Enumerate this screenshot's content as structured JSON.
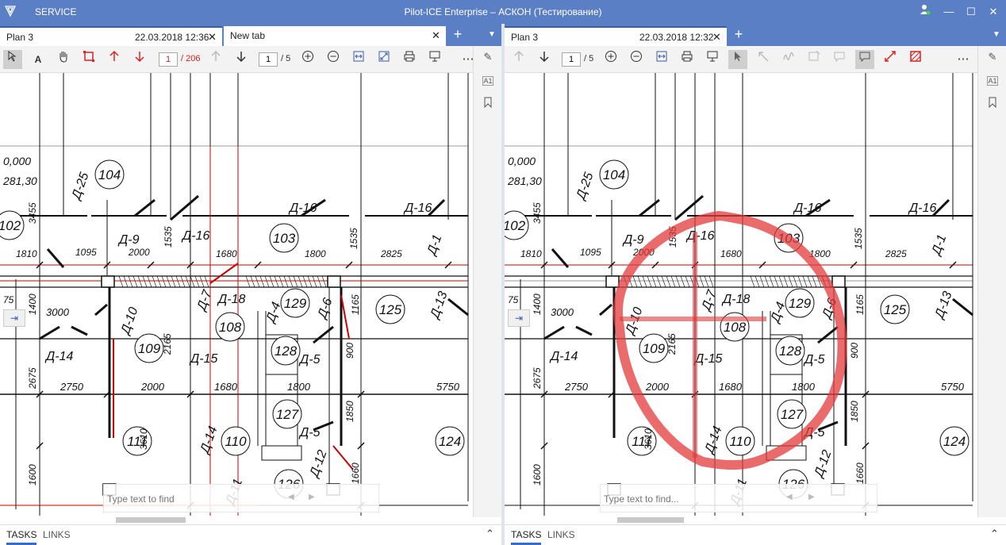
{
  "titlebar": {
    "menu": "SERVICE",
    "title": "Pilot-ICE Enterprise – АСКОН (Тестирование)",
    "user_icon": "user-status-icon",
    "minimize": "—",
    "maximize": "☐",
    "close": "✕"
  },
  "left": {
    "tab1": {
      "label": "Plan 3",
      "date": "22.03.2018 12:36",
      "close": "✕"
    },
    "tab2": {
      "label": "New tab",
      "close": "✕"
    },
    "add_tab": "+",
    "dropdown": "▼",
    "page_current": "1",
    "page_total": "/ 206",
    "page_current2": "1",
    "page_total2": "/ 5",
    "find_placeholder": "Type text to find",
    "bottom_tabs": [
      "TASKS",
      "LINKS"
    ]
  },
  "right": {
    "tab1": {
      "label": "Plan 3",
      "date": "22.03.2018 12:32",
      "close": "✕"
    },
    "add_tab": "+",
    "dropdown": "▼",
    "page_current": "1",
    "page_total": "/ 5",
    "find_placeholder": "Type text to find...",
    "bottom_tabs": [
      "TASKS",
      "LINKS"
    ]
  },
  "drawing": {
    "rooms": [
      "104",
      "102",
      "103",
      "129",
      "125",
      "109",
      "108",
      "128",
      "127",
      "111",
      "110",
      "124",
      "126"
    ],
    "labels": [
      "Д-25",
      "Д-9",
      "Д-16",
      "Д-16",
      "Д-16",
      "Д-1",
      "Д-18",
      "Д-4",
      "Д-6",
      "Д-13",
      "Д-10",
      "Д-7",
      "Д-14",
      "Д-15",
      "Д-5",
      "Д-5",
      "Д-14",
      "Д-12",
      "Д-11"
    ],
    "dims": [
      "0,000",
      "281,30",
      "3455",
      "1810",
      "1095",
      "2000",
      "1535",
      "1680",
      "1800",
      "1535",
      "2825",
      "75",
      "1400",
      "3000",
      "2165",
      "1165",
      "900",
      "2675",
      "2750",
      "2000",
      "1680",
      "1800",
      "5750",
      "1850",
      "3610",
      "1600",
      "1660"
    ]
  },
  "colors": {
    "accent": "#5b7fc4",
    "markup_red": "#e23a3a"
  }
}
